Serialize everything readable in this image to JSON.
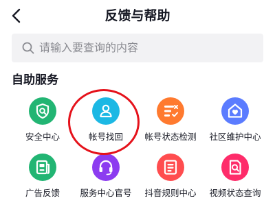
{
  "header": {
    "title": "反馈与帮助"
  },
  "search": {
    "placeholder": "请输入要查询的内容"
  },
  "section": {
    "title": "自助服务"
  },
  "colors": {
    "green": "#22b573",
    "cyan": "#1cb8e4",
    "orange": "#ff7a2f",
    "blue": "#5b7cff",
    "purple": "#8c3cf0",
    "red": "#ff4d4f",
    "pink": "#fe2c6a",
    "highlight": "#e5121b"
  },
  "services": [
    {
      "label": "安全中心",
      "icon": "shield-icon",
      "color": "#22b573"
    },
    {
      "label": "帐号找回",
      "icon": "user-icon",
      "color": "#1cb8e4"
    },
    {
      "label": "帐号状态检测",
      "icon": "status-check-icon",
      "color": "#ff7a2f"
    },
    {
      "label": "社区维护中心",
      "icon": "heart-house-icon",
      "color": "#5b7cff"
    },
    {
      "label": "广告反馈",
      "icon": "ad-document-icon",
      "color": "#22b573"
    },
    {
      "label": "服务中心官号",
      "icon": "headset-icon",
      "color": "#8c3cf0"
    },
    {
      "label": "抖音规则中心",
      "icon": "rules-document-icon",
      "color": "#ff4d4f"
    },
    {
      "label": "视频状态查询",
      "icon": "video-search-icon",
      "color": "#fe2c6a"
    }
  ]
}
